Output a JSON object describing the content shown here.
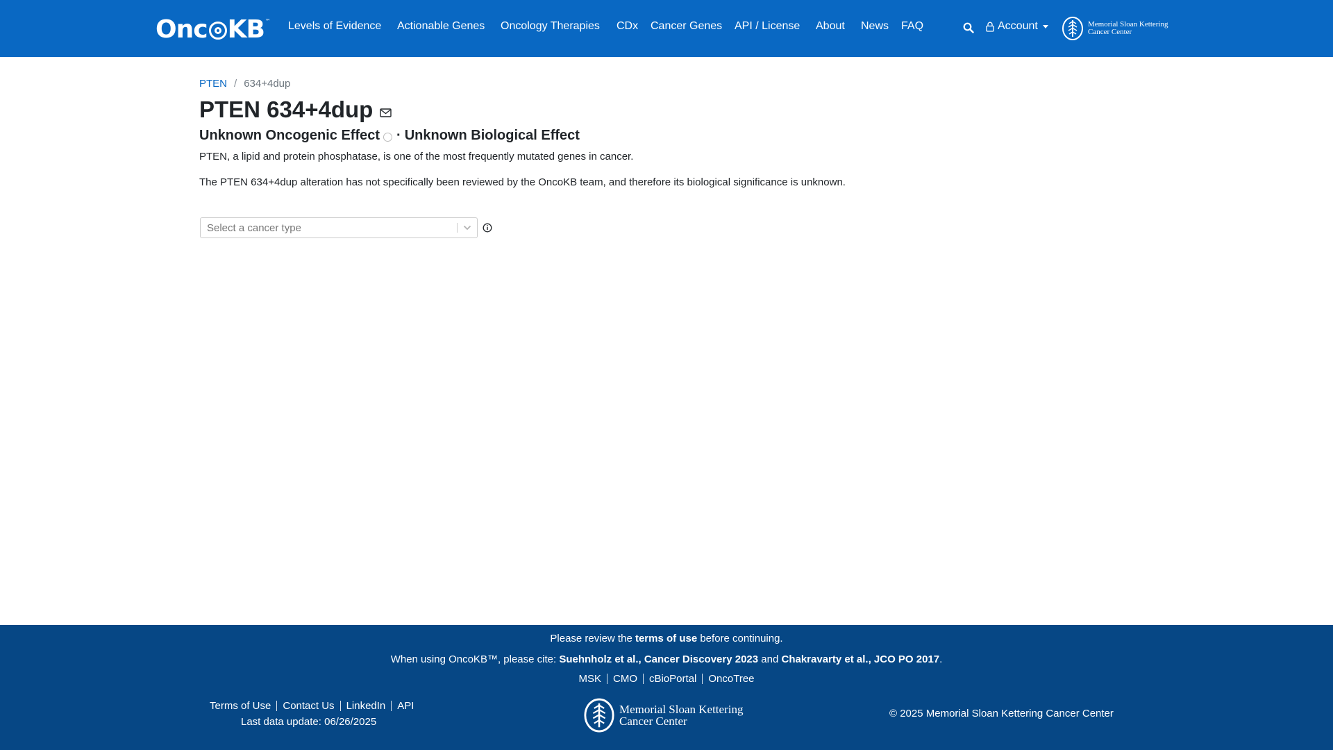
{
  "nav": {
    "brand": {
      "text_a": "Onc",
      "text_b": "KB",
      "tm": "™"
    },
    "items": [
      {
        "label": "Levels of Evidence"
      },
      {
        "label": "Actionable Genes"
      },
      {
        "label": "Oncology Therapies"
      },
      {
        "label": "CDx"
      },
      {
        "label": "Cancer Genes"
      },
      {
        "label": "API / License"
      },
      {
        "label": "About"
      },
      {
        "label": "News"
      },
      {
        "label": "FAQ"
      }
    ],
    "account_label": "Account",
    "msk_line1": "Memorial Sloan Kettering",
    "msk_line2": "Cancer Center"
  },
  "breadcrumb": {
    "gene": "PTEN",
    "separator": "/",
    "current": "634+4dup"
  },
  "page": {
    "title": "PTEN 634+4dup",
    "oncogenic_effect": "Unknown Oncogenic Effect",
    "effect_separator": "·",
    "biological_effect": "Unknown Biological Effect",
    "gene_summary": "PTEN, a lipid and protein phosphatase, is one of the most frequently mutated genes in cancer.",
    "alteration_summary": "The PTEN 634+4dup alteration has not specifically been reviewed by the OncoKB team, and therefore its biological significance is unknown."
  },
  "cancer_type_select": {
    "placeholder": "Select a cancer type"
  },
  "footer": {
    "review_pre": "Please review the ",
    "review_link": "terms of use",
    "review_post": " before continuing.",
    "cite_pre": "When using OncoKB™, please cite: ",
    "cite_1": "Suehnholz et al., Cancer Discovery 2023",
    "cite_and": " and ",
    "cite_2": "Chakravarty et al., JCO PO 2017",
    "cite_end": ".",
    "links": [
      {
        "label": "MSK"
      },
      {
        "label": "CMO"
      },
      {
        "label": "cBioPortal"
      },
      {
        "label": "OncoTree"
      }
    ],
    "left_links": [
      {
        "label": "Terms of Use"
      },
      {
        "label": "Contact Us"
      },
      {
        "label": "LinkedIn"
      },
      {
        "label": "API"
      }
    ],
    "last_update": "Last data update: 06/26/2025",
    "msk_line1": "Memorial Sloan Kettering",
    "msk_line2": "Cancer Center",
    "copyright": "© 2025 Memorial Sloan Kettering Cancer Center"
  },
  "colors": {
    "navbar": "#0968c3",
    "footer": "#064785",
    "link": "#0968c3"
  }
}
